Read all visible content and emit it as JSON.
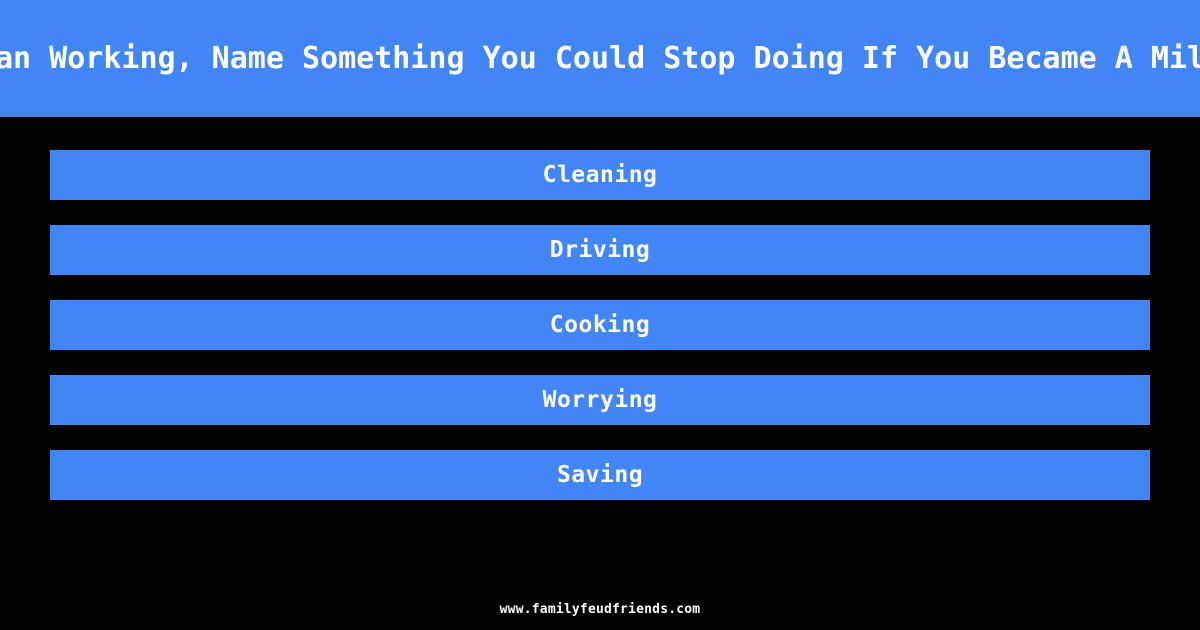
{
  "page": {
    "background_color": "#000000",
    "accent_color": "#4285f4",
    "text_color": "#ffffff"
  },
  "header": {
    "question": "Other Than Working, Name Something You Could Stop Doing If You Became A Millionaire",
    "visible_question_fragment": "r Than Working, Name Something You Could Stop Doing If You Became A Million"
  },
  "answers": [
    {
      "label": "Cleaning"
    },
    {
      "label": "Driving"
    },
    {
      "label": "Cooking"
    },
    {
      "label": "Worrying"
    },
    {
      "label": "Saving"
    }
  ],
  "footer": {
    "site": "www.familyfeudfriends.com"
  }
}
